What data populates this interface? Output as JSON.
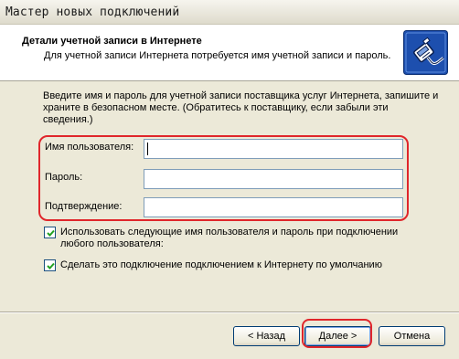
{
  "window": {
    "title": "Мастер новых подключений"
  },
  "header": {
    "title": "Детали учетной записи в Интернете",
    "subtitle": "Для учетной записи Интернета потребуется имя учетной записи и пароль.",
    "icon": "phone-connector-icon"
  },
  "intro": {
    "line1": "Введите имя и пароль для учетной записи поставщика услуг Интернета, запишите и",
    "line2": "храните в безопасном месте. (Обратитесь к поставщику, если забыли эти",
    "line3": "сведения.)"
  },
  "form": {
    "username": {
      "label": "Имя пользователя:",
      "value": ""
    },
    "password": {
      "label": "Пароль:",
      "value": ""
    },
    "confirm": {
      "label": "Подтверждение:",
      "value": ""
    }
  },
  "checkboxes": {
    "use_for_all": {
      "line1": "Использовать следующие имя пользователя и пароль при подключении",
      "line2": "любого пользователя:",
      "checked": true
    },
    "default_connection": {
      "line1": "Сделать это подключение подключением к Интернету по умолчанию",
      "checked": true
    }
  },
  "buttons": {
    "back": "< Назад",
    "next": "Далее >",
    "cancel": "Отмена"
  },
  "colors": {
    "highlight": "#e0262b",
    "window_bg": "#ece9d8",
    "input_border": "#7f9db9"
  }
}
